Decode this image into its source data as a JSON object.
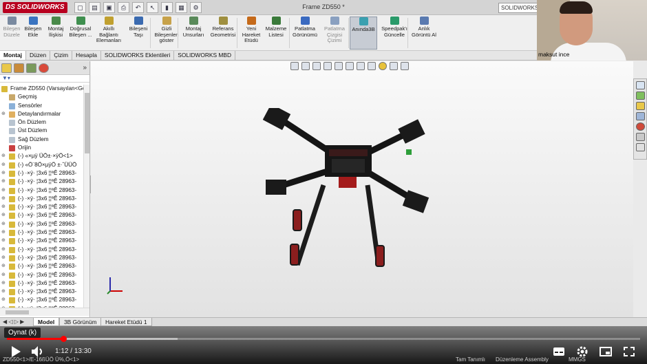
{
  "app": {
    "logo": "DS SOLIDWORKS",
    "document_title": "Frame ZD550 *",
    "search_placeholder": "SOLIDWORKS"
  },
  "colors": {
    "brand": "#b8001f",
    "youtube_red": "#ff0000",
    "highlight_green": "#2e9e3a"
  },
  "ribbon": [
    {
      "label": "Bileşen Düzele",
      "icon": "component-edit-icon",
      "dim": true
    },
    {
      "label": "Bileşen Ekle",
      "icon": "insert-component-icon"
    },
    {
      "label": "Montaj İlişkisi",
      "icon": "mate-icon"
    },
    {
      "label": "Doğrusal Bileşen ...",
      "icon": "linear-pattern-icon"
    },
    {
      "label": "Akıllı Bağlantı Elemanları",
      "icon": "smart-fasteners-icon"
    },
    {
      "label": "Bileşeni Taşı",
      "icon": "move-component-icon"
    },
    {
      "label": "Gizli Bileşenleri göster",
      "icon": "show-hidden-icon"
    },
    {
      "label": "Montaj Unsurları",
      "icon": "assembly-features-icon"
    },
    {
      "label": "Referans Geometrisi",
      "icon": "reference-geometry-icon"
    },
    {
      "label": "Yeni Hareket Etüdü",
      "icon": "motion-study-icon"
    },
    {
      "label": "Malzeme Listesi",
      "icon": "bom-icon"
    },
    {
      "label": "Patlatma Görünümü",
      "icon": "exploded-view-icon"
    },
    {
      "label": "Patlatma Çizgisi Çizimi",
      "icon": "explode-line-icon",
      "dim": true
    },
    {
      "label": "Anında3B",
      "icon": "instant3d-icon",
      "selected": true
    },
    {
      "label": "Speedpak'ı Güncelle",
      "icon": "speedpak-icon"
    },
    {
      "label": "Anlık Görüntü Al",
      "icon": "snapshot-icon"
    }
  ],
  "command_tabs": [
    "Montaj",
    "Düzen",
    "Çizim",
    "Hesapla",
    "SOLIDWORKS Eklentileri",
    "SOLIDWORKS MBD"
  ],
  "webcam": {
    "name": "maksut ince"
  },
  "feature_tree": {
    "filter_icon": "filter-icon",
    "root": "Frame ZD550  (Varsayılan<Gö",
    "items": [
      "Geçmiş",
      "Sensörler",
      "Detaylandırmalar",
      "Ön Düzlem",
      "Üst Düzlem",
      "Sağ Düzlem",
      "Orijin",
      "(-) «×µÿ  ÜÖ±·×ÿÖ<1>",
      "(-) «Ö¨8Ö×µÿÖ  ±·ˆÜÜÖ",
      "(-) ·×ÿ· ¦3x6 ¦¦ªÊ 28963-",
      "(-) ·×ÿ· ¦3x6 ¦¦ªÊ 28963-",
      "(-) ·×ÿ· ¦3x6 ¦¦ªÊ 28963-",
      "(-) ·×ÿ· ¦3x6 ¦¦ªÊ 28963-",
      "(-) ·×ÿ· ¦3x6 ¦¦ªÊ 28963-",
      "(-) ·×ÿ· ¦3x6 ¦¦ªÊ 28963-",
      "(-) ·×ÿ· ¦3x6 ¦¦ªÊ 28963-",
      "(-) ·×ÿ· ¦3x6 ¦¦ªÊ 28963-",
      "(-) ·×ÿ· ¦3x6 ¦¦ªÊ 28963-",
      "(-) ·×ÿ· ¦3x6 ¦¦ªÊ 28963-",
      "(-) ·×ÿ· ¦3x6 ¦¦ªÊ 28963-",
      "(-) ·×ÿ· ¦3x6 ¦¦ªÊ 28963-",
      "(-) ·×ÿ· ¦3x6 ¦¦ªÊ 28963-",
      "(-) ·×ÿ· ¦3x6 ¦¦ªÊ 28963-",
      "(-) ·×ÿ· ¦3x6 ¦¦ªÊ 28963-",
      "(-) ·×ÿ· ¦3x6 ¦¦ªÊ 28963-",
      "(-) ·×ÿ· ¦3x6 ¦¦ªÊ 28963-"
    ]
  },
  "bottom_tabs": [
    "Model",
    "3B Görünüm",
    "Hareket Etüdü 1"
  ],
  "status": {
    "left": "ZD550<1>/E-16ßÜÖ Ü%,Ö<1>",
    "define": "Tam Tanımlı",
    "mode": "Düzenleme Assembly",
    "units": "MMGS"
  },
  "player": {
    "tooltip": "Oynat (k)",
    "current_time": "1:12",
    "duration": "13:30",
    "progress": 0.089,
    "buffered": 0.27
  }
}
